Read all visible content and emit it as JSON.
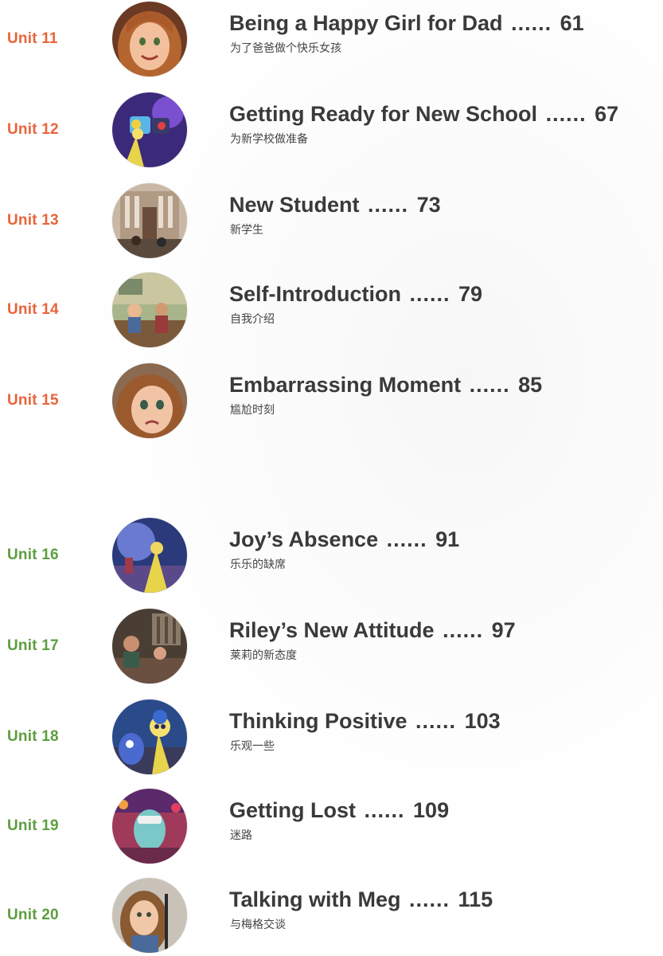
{
  "toc": {
    "entries": [
      {
        "unit": "Unit 11",
        "title": "Being a Happy Girl for Dad",
        "dots": "......",
        "page": "61",
        "subtitle": "为了爸爸做个快乐女孩",
        "color": "#e8643a"
      },
      {
        "unit": "Unit 12",
        "title": "Getting Ready for New School",
        "dots": "......",
        "page": "67",
        "subtitle": "为新学校做准备",
        "color": "#e8643a"
      },
      {
        "unit": "Unit 13",
        "title": "New Student",
        "dots": "......",
        "page": "73",
        "subtitle": "新学生",
        "color": "#e8643a"
      },
      {
        "unit": "Unit 14",
        "title": "Self-Introduction",
        "dots": "......",
        "page": "79",
        "subtitle": "自我介绍",
        "color": "#e8643a"
      },
      {
        "unit": "Unit 15",
        "title": "Embarrassing Moment",
        "dots": "......",
        "page": "85",
        "subtitle": "尴尬时刻",
        "color": "#e8643a"
      },
      {
        "unit": "Unit 16",
        "title": "Joy’s Absence",
        "dots": "......",
        "page": "91",
        "subtitle": "乐乐的缺席",
        "color": "#5d9e3f"
      },
      {
        "unit": "Unit 17",
        "title": "Riley’s New Attitude",
        "dots": "......",
        "page": "97",
        "subtitle": "莱莉的新态度",
        "color": "#5d9e3f"
      },
      {
        "unit": "Unit 18",
        "title": "Thinking Positive",
        "dots": "......",
        "page": "103",
        "subtitle": "乐观一些",
        "color": "#5d9e3f"
      },
      {
        "unit": "Unit 19",
        "title": "Getting Lost",
        "dots": "......",
        "page": "109",
        "subtitle": "迷路",
        "color": "#5d9e3f"
      },
      {
        "unit": "Unit 20",
        "title": "Talking with Meg",
        "dots": "......",
        "page": "115",
        "subtitle": "与梅格交谈",
        "color": "#5d9e3f"
      }
    ],
    "thumbnails": [
      "riley-smiling-portrait-icon",
      "joy-with-memory-orbs-icon",
      "school-building-icon",
      "classroom-scene-icon",
      "riley-sad-portrait-icon",
      "headquarters-scene-icon",
      "family-dinner-icon",
      "joy-and-sadness-icon",
      "bing-bong-character-icon",
      "riley-and-meg-icon"
    ]
  }
}
